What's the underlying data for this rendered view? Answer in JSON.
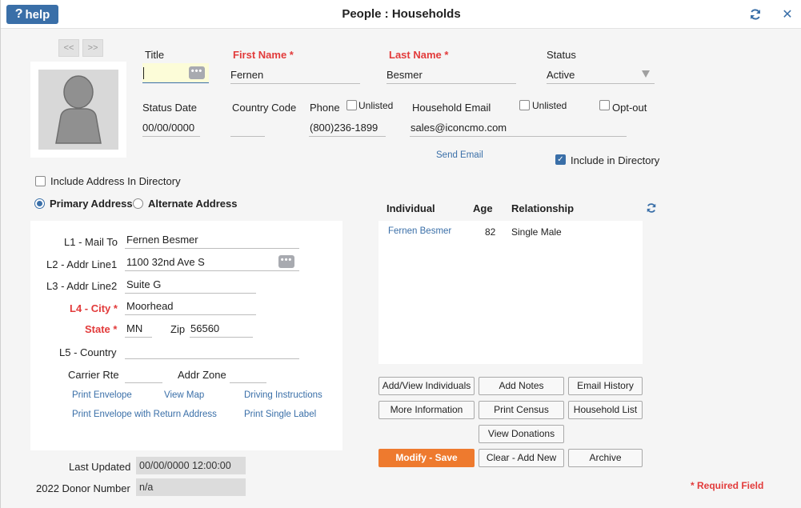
{
  "window": {
    "help_label": "help",
    "title": "People : Households"
  },
  "nav": {
    "prev_label": "<<",
    "next_label": ">>"
  },
  "person": {
    "title_label": "Title",
    "title_value": "",
    "first_name_label": "First Name *",
    "first_name_value": "Fernen",
    "last_name_label": "Last Name *",
    "last_name_value": "Besmer",
    "status_label": "Status",
    "status_value": "Active",
    "status_date_label": "Status Date",
    "status_date_value": "00/00/0000",
    "country_code_label": "Country Code",
    "country_code_value": "",
    "phone_label": "Phone",
    "phone_unlisted_label": "Unlisted",
    "phone_value": "(800)236-1899",
    "household_email_label": "Household Email",
    "email_unlisted_label": "Unlisted",
    "opt_out_label": "Opt-out",
    "email_value": "sales@iconcmo.com",
    "send_email_label": "Send Email",
    "include_directory_label": "Include in Directory",
    "include_directory_checked": true
  },
  "address": {
    "include_address_label": "Include Address In Directory",
    "primary_label": "Primary Address",
    "alternate_label": "Alternate Address",
    "l1_label": "L1 - Mail To",
    "l1_value": "Fernen Besmer",
    "l2_label": "L2 - Addr Line1",
    "l2_value": "1100 32nd Ave S",
    "l3_label": "L3 - Addr Line2",
    "l3_value": "Suite G",
    "l4_label": "L4 - City *",
    "l4_value": "Moorhead",
    "state_label": "State *",
    "state_value": "MN",
    "zip_label": "Zip",
    "zip_value": "56560",
    "l5_label": "L5 - Country",
    "l5_value": "",
    "carrier_label": "Carrier Rte",
    "carrier_value": "",
    "addr_zone_label": "Addr Zone",
    "addr_zone_value": "",
    "links": {
      "print_envelope": "Print Envelope",
      "view_map": "View Map",
      "driving_instructions": "Driving Instructions",
      "print_envelope_return": "Print Envelope with Return Address",
      "print_single_label": "Print Single Label"
    }
  },
  "meta": {
    "last_updated_label": "Last Updated",
    "last_updated_value": "00/00/0000 12:00:00",
    "donor_label": "2022 Donor Number",
    "donor_value": "n/a"
  },
  "individuals": {
    "columns": [
      "Individual",
      "Age",
      "Relationship"
    ],
    "rows": [
      {
        "name": "Fernen Besmer",
        "age": "82",
        "relationship": "Single Male"
      }
    ]
  },
  "buttons": {
    "add_view_individuals": "Add/View Individuals",
    "add_notes": "Add Notes",
    "email_history": "Email History",
    "more_information": "More Information",
    "print_census": "Print Census",
    "household_list": "Household List",
    "view_donations": "View Donations",
    "modify_save": "Modify - Save",
    "clear_add_new": "Clear - Add New",
    "archive": "Archive"
  },
  "required_note": "* Required Field",
  "colors": {
    "accent": "#3a6fa8",
    "required": "#e23b3b",
    "primary_button": "#ee7a2e"
  },
  "icons": {
    "refresh": "refresh-icon",
    "close": "close-icon",
    "help": "question-icon",
    "lookup": "ellipsis-icon",
    "avatar": "person-silhouette-icon"
  }
}
